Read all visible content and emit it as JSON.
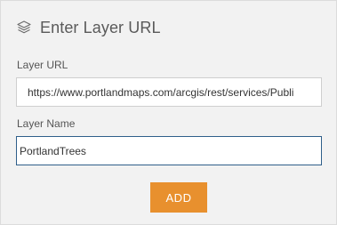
{
  "header": {
    "title": "Enter Layer URL",
    "icon": "layers-icon"
  },
  "form": {
    "url_label": "Layer URL",
    "url_value": "https://www.portlandmaps.com/arcgis/rest/services/Publi",
    "name_label": "Layer Name",
    "name_value": "PortlandTrees"
  },
  "actions": {
    "add_label": "ADD"
  },
  "colors": {
    "accent": "#e8902e",
    "focus_border": "#2f5f8a",
    "panel_bg": "#f2f2f2"
  }
}
